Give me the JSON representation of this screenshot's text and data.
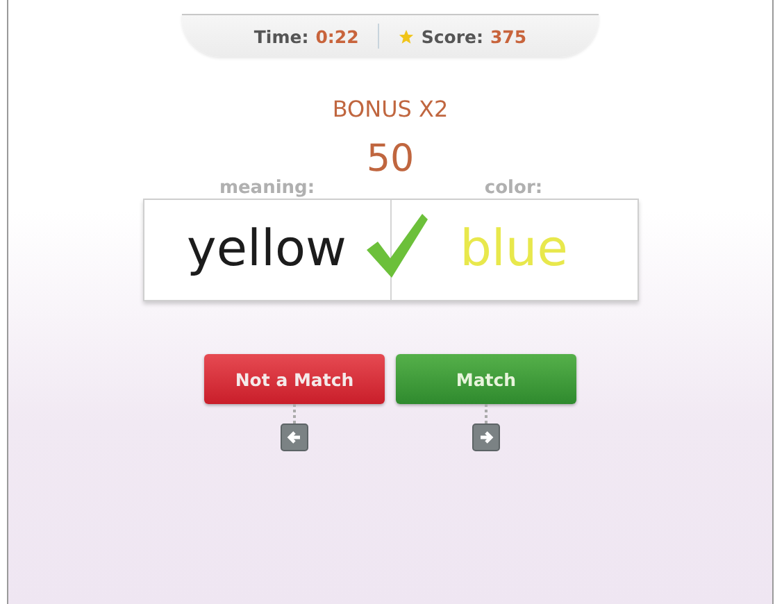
{
  "stats": [
    {
      "label": "Time:",
      "value": "0:22",
      "kind": "time"
    },
    {
      "label": "Score:",
      "value": "375",
      "kind": "score"
    }
  ],
  "bonus": "BONUS X2",
  "points": "50",
  "cards": [
    {
      "label": "meaning:",
      "word": "yellow",
      "color": "#1c1c1c"
    },
    {
      "label": "color:",
      "word": "blue",
      "color": "#e8e84c"
    }
  ],
  "correct": true,
  "buttons": [
    {
      "label": "Not a Match",
      "kind": "no"
    },
    {
      "label": "Match",
      "kind": "yes"
    }
  ]
}
